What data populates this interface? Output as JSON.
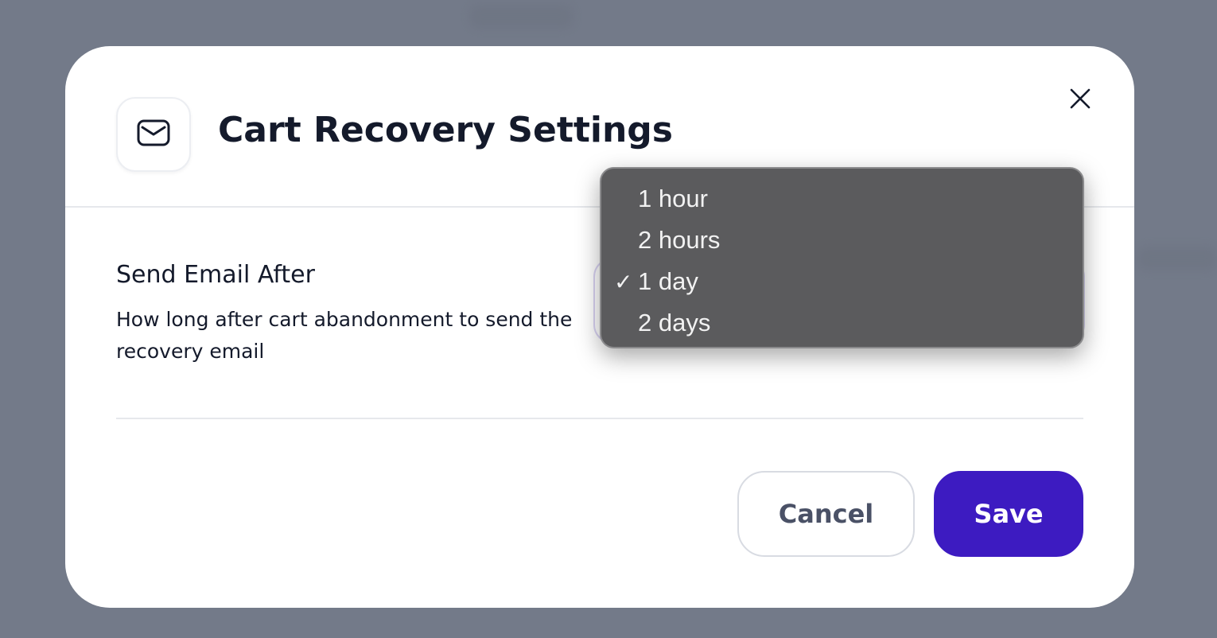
{
  "modal": {
    "title": "Cart Recovery Settings",
    "icon": "mail-icon",
    "close_icon": "close-icon"
  },
  "setting": {
    "label": "Send Email After",
    "description": "How long after cart abandonment to send the recovery email",
    "selected_value": "1 day"
  },
  "dropdown": {
    "options": [
      {
        "label": "1 hour",
        "selected": false
      },
      {
        "label": "2 hours",
        "selected": false
      },
      {
        "label": "1 day",
        "selected": true
      },
      {
        "label": "2 days",
        "selected": false
      }
    ],
    "check_glyph": "✓"
  },
  "footer": {
    "cancel_label": "Cancel",
    "save_label": "Save"
  },
  "colors": {
    "backdrop": "#737a89",
    "primary": "#3d1bc1",
    "text": "#141a2b",
    "dropdown_bg": "#5b5b5d"
  }
}
